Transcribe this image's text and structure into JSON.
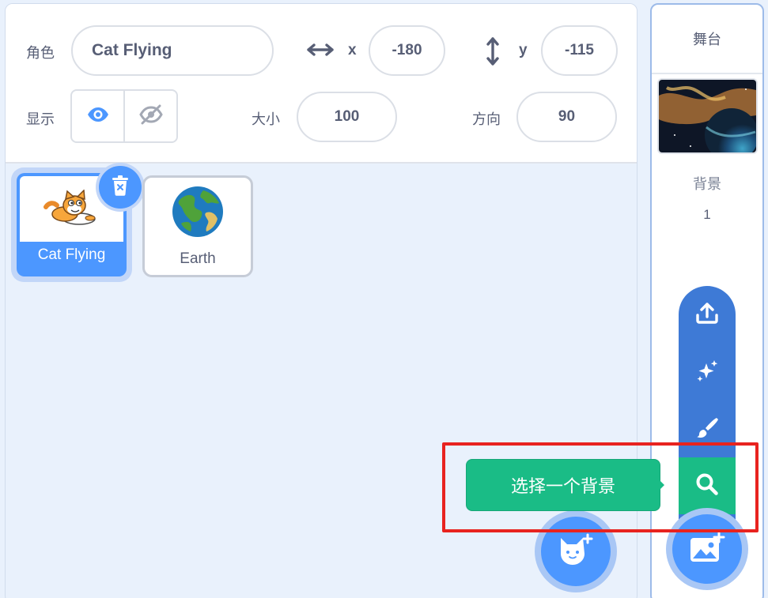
{
  "sprite_info": {
    "sprite_label": "角色",
    "sprite_name": "Cat Flying",
    "x_label": "x",
    "x_value": "-180",
    "y_label": "y",
    "y_value": "-115",
    "show_label": "显示",
    "size_label": "大小",
    "size_value": "100",
    "direction_label": "方向",
    "direction_value": "90"
  },
  "sprites": [
    {
      "name": "Cat Flying",
      "selected": true
    },
    {
      "name": "Earth",
      "selected": false
    }
  ],
  "stage": {
    "title": "舞台",
    "backdrops_label": "背景",
    "backdrops_count": "1"
  },
  "backdrop_menu": {
    "tooltip": "选择一个背景",
    "items": [
      "upload-icon",
      "surprise-icon",
      "paint-icon",
      "search-icon"
    ]
  },
  "colors": {
    "accent": "#4c97ff",
    "menu": "#3e7ad6",
    "active_item": "#1abc86",
    "highlight": "#e8231f"
  }
}
